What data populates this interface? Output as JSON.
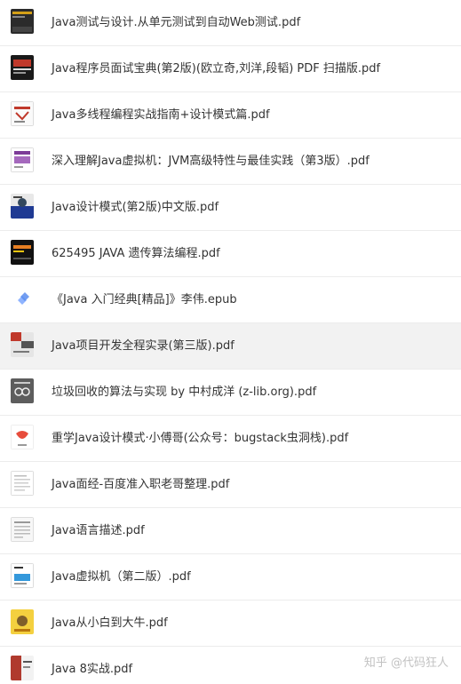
{
  "files": [
    {
      "name": "Java测试与设计.从单元测试到自动Web测试.pdf",
      "thumb_icon": "book-cover-dark-icon"
    },
    {
      "name": "Java程序员面试宝典(第2版)(欧立奇,刘洋,段韬) PDF 扫描版.pdf",
      "thumb_icon": "book-cover-black-red-icon"
    },
    {
      "name": "Java多线程编程实战指南+设计模式篇.pdf",
      "thumb_icon": "book-cover-white-red-icon"
    },
    {
      "name": "深入理解Java虚拟机：JVM高级特性与最佳实践（第3版）.pdf",
      "thumb_icon": "book-cover-purple-icon"
    },
    {
      "name": "Java设计模式(第2版)中文版.pdf",
      "thumb_icon": "book-cover-blue-icon"
    },
    {
      "name": "625495 JAVA 遗传算法编程.pdf",
      "thumb_icon": "book-cover-black-orange-icon"
    },
    {
      "name": "《Java 入门经典[精品]》李伟.epub",
      "thumb_icon": "epub-file-icon"
    },
    {
      "name": "Java项目开发全程实录(第三版).pdf",
      "thumb_icon": "book-cover-red-gray-icon"
    },
    {
      "name": "垃圾回收的算法与实现 by 中村成洋 (z-lib.org).pdf",
      "thumb_icon": "book-cover-gray-glasses-icon"
    },
    {
      "name": "重学Java设计模式·小傅哥(公众号：bugstack虫洞栈).pdf",
      "thumb_icon": "book-cover-red-ribbon-icon"
    },
    {
      "name": "Java面经-百度准入职老哥整理.pdf",
      "thumb_icon": "document-page-icon"
    },
    {
      "name": "Java语言描述.pdf",
      "thumb_icon": "document-page-lines-icon"
    },
    {
      "name": "Java虚拟机（第二版）.pdf",
      "thumb_icon": "book-cover-white-blue-icon"
    },
    {
      "name": "Java从小白到大牛.pdf",
      "thumb_icon": "book-cover-yellow-icon"
    },
    {
      "name": "Java 8实战.pdf",
      "thumb_icon": "book-cover-red-white-icon"
    }
  ],
  "highlighted_index": 7,
  "watermark": "知乎 @代码狂人"
}
